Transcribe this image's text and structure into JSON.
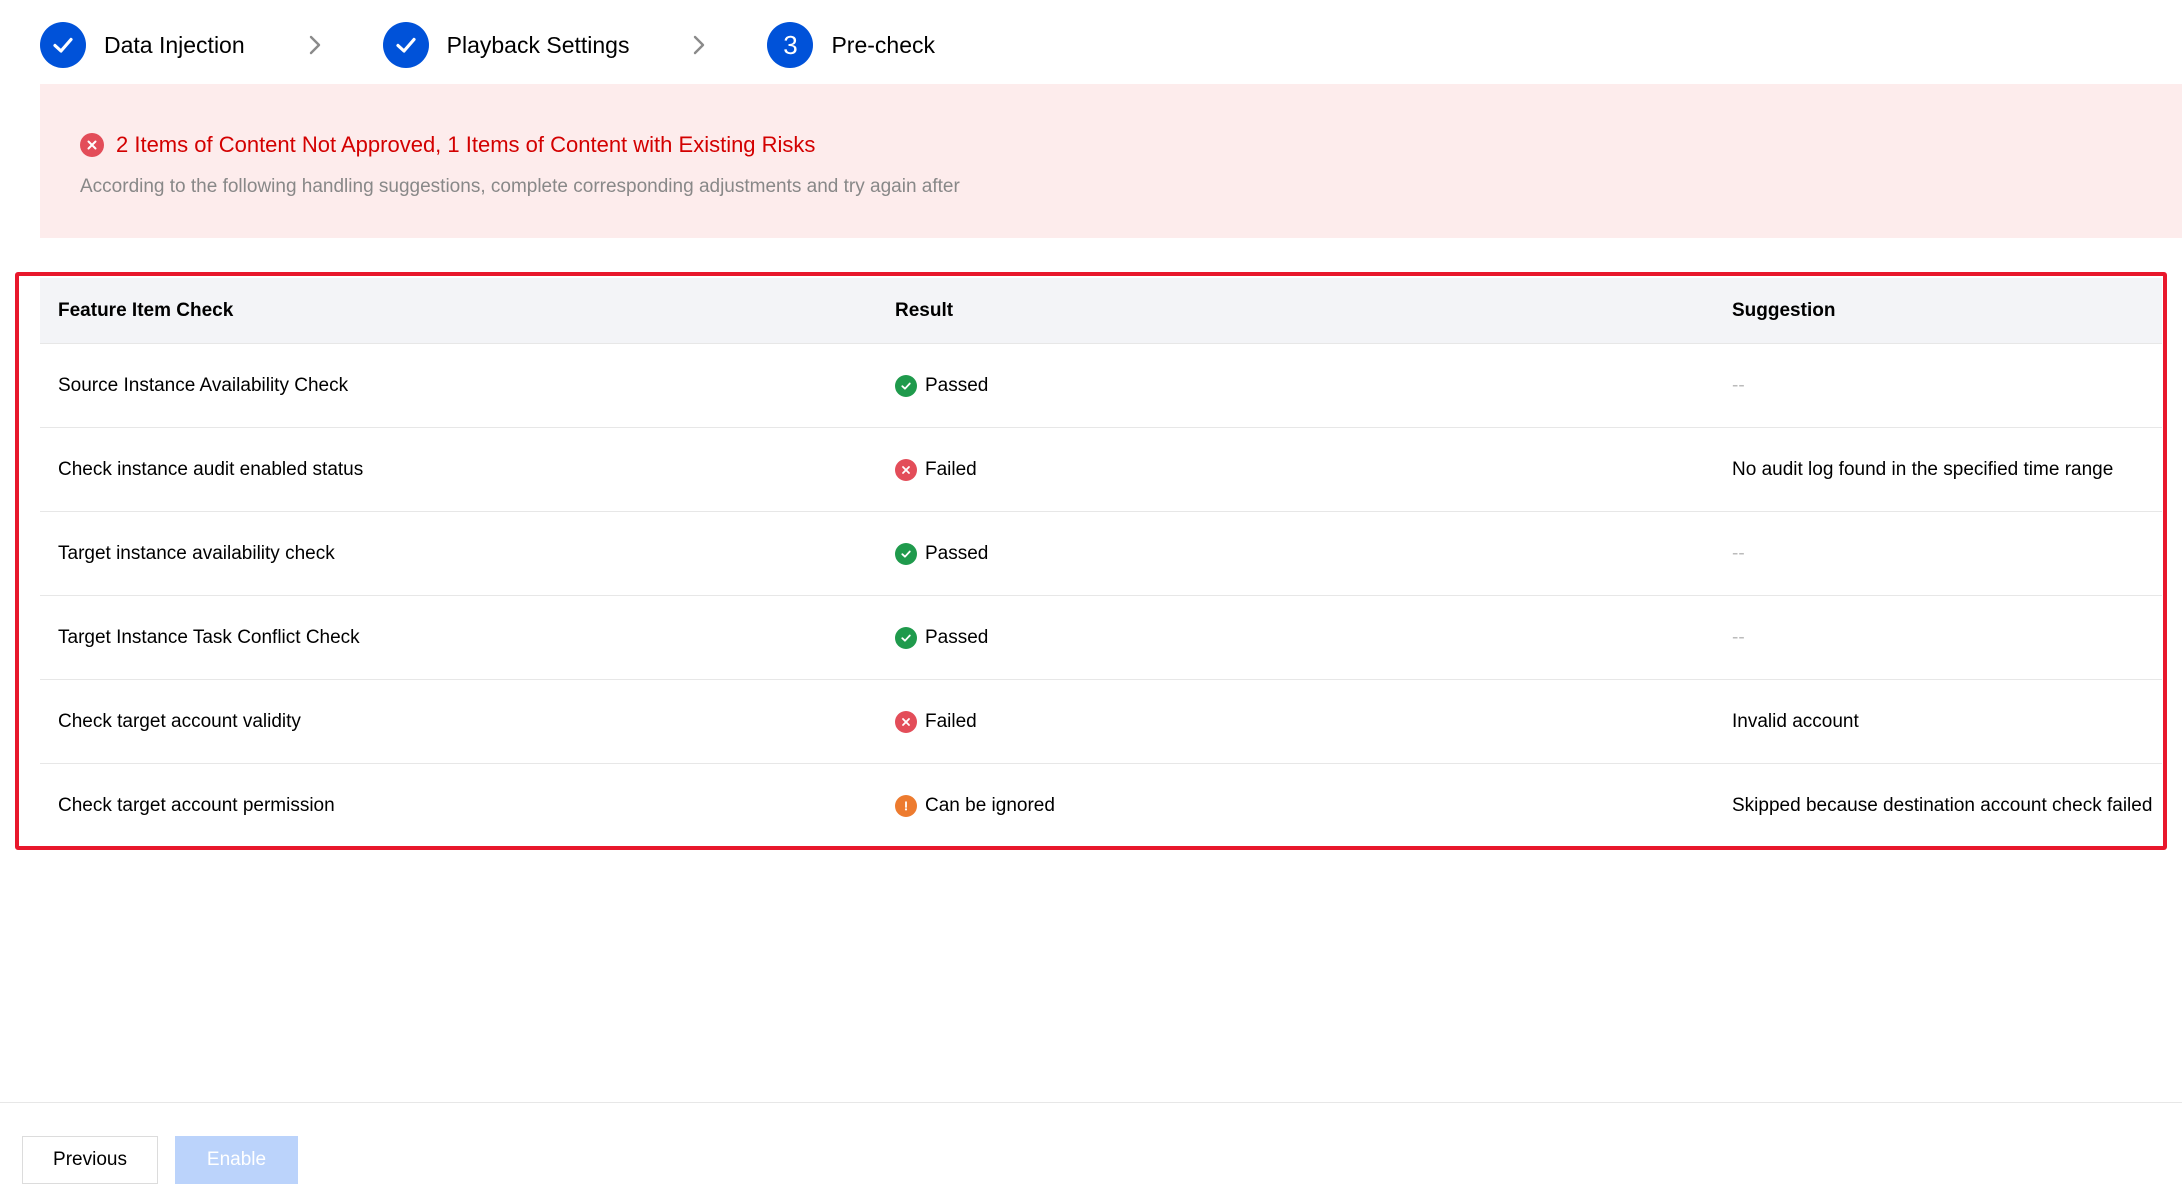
{
  "stepper": {
    "steps": [
      {
        "label": "Data Injection",
        "state": "done"
      },
      {
        "label": "Playback Settings",
        "state": "done"
      },
      {
        "label": "Pre-check",
        "state": "active",
        "number": "3"
      }
    ]
  },
  "alert": {
    "title": "2 Items of Content Not Approved, 1 Items of Content with Existing Risks",
    "description": "According to the following handling suggestions, complete corresponding adjustments and try again after"
  },
  "table": {
    "headers": [
      "Feature Item Check",
      "Result",
      "Suggestion"
    ],
    "rows": [
      {
        "check": "Source Instance Availability Check",
        "result": "Passed",
        "status": "passed",
        "suggestion": "--"
      },
      {
        "check": "Check instance audit enabled status",
        "result": "Failed",
        "status": "failed",
        "suggestion": "No audit log found in the specified time range"
      },
      {
        "check": "Target instance availability check",
        "result": "Passed",
        "status": "passed",
        "suggestion": "--"
      },
      {
        "check": "Target Instance Task Conflict Check",
        "result": "Passed",
        "status": "passed",
        "suggestion": "--"
      },
      {
        "check": "Check target account validity",
        "result": "Failed",
        "status": "failed",
        "suggestion": "Invalid account"
      },
      {
        "check": "Check target account permission",
        "result": "Can be ignored",
        "status": "warning",
        "suggestion": "Skipped because destination account check failed"
      }
    ]
  },
  "footer": {
    "previous_label": "Previous",
    "enable_label": "Enable"
  },
  "colors": {
    "primary": "#0052d9",
    "success": "#1f9a4c",
    "error": "#e34d59",
    "warning": "#ed7b2f",
    "alert_bg": "#fdecec",
    "highlight_border": "#e8172c"
  }
}
